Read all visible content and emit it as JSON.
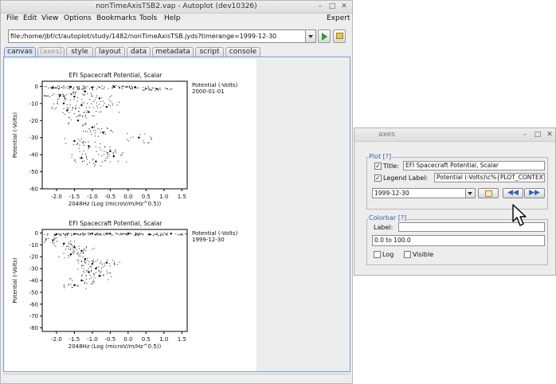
{
  "window": {
    "title": "nonTimeAxisTSB2.vap - Autoplot (dev10326)",
    "menus": [
      "File",
      "Edit",
      "View",
      "Options",
      "Bookmarks",
      "Tools",
      "Help"
    ],
    "expert_label": "Expert"
  },
  "toolbar": {
    "url": "file:/home/jbf/ct/autoplot/study/1482/nonTimeAxisTSB.jyds?timerange=1999-12-30",
    "go_icon": "play-icon",
    "bookmark_icon": "folder-icon"
  },
  "tabs": [
    {
      "label": "canvas",
      "selected": true,
      "enabled": true
    },
    {
      "label": "(axes)",
      "selected": false,
      "enabled": false
    },
    {
      "label": "style",
      "selected": false,
      "enabled": true
    },
    {
      "label": "layout",
      "selected": false,
      "enabled": true
    },
    {
      "label": "data",
      "selected": false,
      "enabled": true
    },
    {
      "label": "metadata",
      "selected": false,
      "enabled": true
    },
    {
      "label": "script",
      "selected": false,
      "enabled": true
    },
    {
      "label": "console",
      "selected": false,
      "enabled": true
    }
  ],
  "chart_data": [
    {
      "type": "scatter",
      "title": "EFI  Spacecraft Potential, Scalar",
      "xlabel": "2048Hz (Log (microV/m/Hz^0.5))",
      "ylabel": "Potential (-Volts)",
      "xlim": [
        -2.4,
        1.65
      ],
      "ylim": [
        -60,
        3
      ],
      "x_ticks": [
        "-2.0",
        "-1.5",
        "-1.0",
        "-0.5",
        "0.0",
        "0.5",
        "1.0",
        "1.5"
      ],
      "y_ticks": [
        "0",
        "-10",
        "-20",
        "-30",
        "-40",
        "-50",
        "-60"
      ],
      "y_tick_values": [
        0,
        -10,
        -20,
        -30,
        -40,
        -50,
        -60
      ],
      "x_tick_values": [
        -2.0,
        -1.5,
        -1.0,
        -0.5,
        0.0,
        0.5,
        1.0,
        1.5
      ],
      "legend": [
        "Potential (-Volts)",
        "2000-01-01"
      ],
      "series": [
        {
          "name": "Potential (-Volts) 2000-01-01",
          "values": [
            [
              -2.1,
              -0.5
            ],
            [
              -1.6,
              -0.3
            ],
            [
              -1.0,
              -0.6
            ],
            [
              -0.4,
              -0.2
            ],
            [
              0.2,
              -0.4
            ],
            [
              0.8,
              -1.5
            ],
            [
              -1.9,
              -5
            ],
            [
              -1.5,
              -6
            ],
            [
              -1.2,
              -3
            ],
            [
              -0.8,
              -7
            ],
            [
              -1.8,
              -10
            ],
            [
              -1.3,
              -11
            ],
            [
              -1.7,
              -14
            ],
            [
              -1.1,
              -15
            ],
            [
              -0.6,
              -12
            ],
            [
              -1.4,
              -20
            ],
            [
              -1.0,
              -24
            ],
            [
              -0.7,
              -27
            ],
            [
              -1.5,
              -32
            ],
            [
              -1.1,
              -35
            ],
            [
              -0.5,
              -38
            ],
            [
              -1.3,
              -42
            ],
            [
              -0.9,
              -44
            ],
            [
              -0.4,
              -41
            ],
            [
              0.3,
              -30
            ]
          ]
        }
      ],
      "grid": false
    },
    {
      "type": "scatter",
      "title": "EFI  Spacecraft Potential, Scalar",
      "xlabel": "2048Hz (Log (microV/m/Hz^0.5))",
      "ylabel": "Potential (-Volts)",
      "xlim": [
        -2.4,
        1.65
      ],
      "ylim": [
        -83,
        3
      ],
      "x_ticks": [
        "-2.0",
        "-1.5",
        "-1.0",
        "-0.5",
        "0.0",
        "0.5",
        "1.0",
        "1.5"
      ],
      "y_ticks": [
        "0",
        "-10",
        "-20",
        "-30",
        "-40",
        "-50",
        "-60",
        "-70",
        "-80"
      ],
      "y_tick_values": [
        0,
        -10,
        -20,
        -30,
        -40,
        -50,
        -60,
        -70,
        -80
      ],
      "x_tick_values": [
        -2.0,
        -1.5,
        -1.0,
        -0.5,
        0.0,
        0.5,
        1.0,
        1.5
      ],
      "legend": [
        "Potential (-Volts)",
        "1999-12-30"
      ],
      "series": [
        {
          "name": "Potential (-Volts) 1999-12-30",
          "values": [
            [
              -2.0,
              -1
            ],
            [
              -1.5,
              -0.8
            ],
            [
              -1.0,
              -0.5
            ],
            [
              -0.5,
              -0.6
            ],
            [
              0.0,
              -0.4
            ],
            [
              0.6,
              -1.2
            ],
            [
              1.2,
              -0.6
            ],
            [
              -2.1,
              -6
            ],
            [
              -1.8,
              -9
            ],
            [
              -1.5,
              -12
            ],
            [
              -1.3,
              -15
            ],
            [
              -1.6,
              -18
            ],
            [
              -1.2,
              -22
            ],
            [
              -1.0,
              -26
            ],
            [
              -0.9,
              -30
            ],
            [
              -1.1,
              -33
            ],
            [
              -0.8,
              -36
            ],
            [
              -1.3,
              -40
            ],
            [
              -1.5,
              -44
            ],
            [
              -0.6,
              -25
            ]
          ]
        }
      ],
      "grid": false
    }
  ],
  "axes_dialog": {
    "title": "axes",
    "plot_group": "Plot [?]",
    "title_label": "Title:",
    "title_value": "EFI  Spacecraft Potential, Scalar",
    "legend_label": "Legend Label:",
    "legend_value": "Potential (-Volts)\\c%{PLOT_CONTEXT",
    "timerange": "1999-12-30",
    "colorbar_group": "Colorbar [?]",
    "colorbar_label": "Label:",
    "colorbar_label_value": "",
    "range_value": "0.0 to 100.0",
    "log_label": "Log",
    "visible_label": "Visible"
  }
}
